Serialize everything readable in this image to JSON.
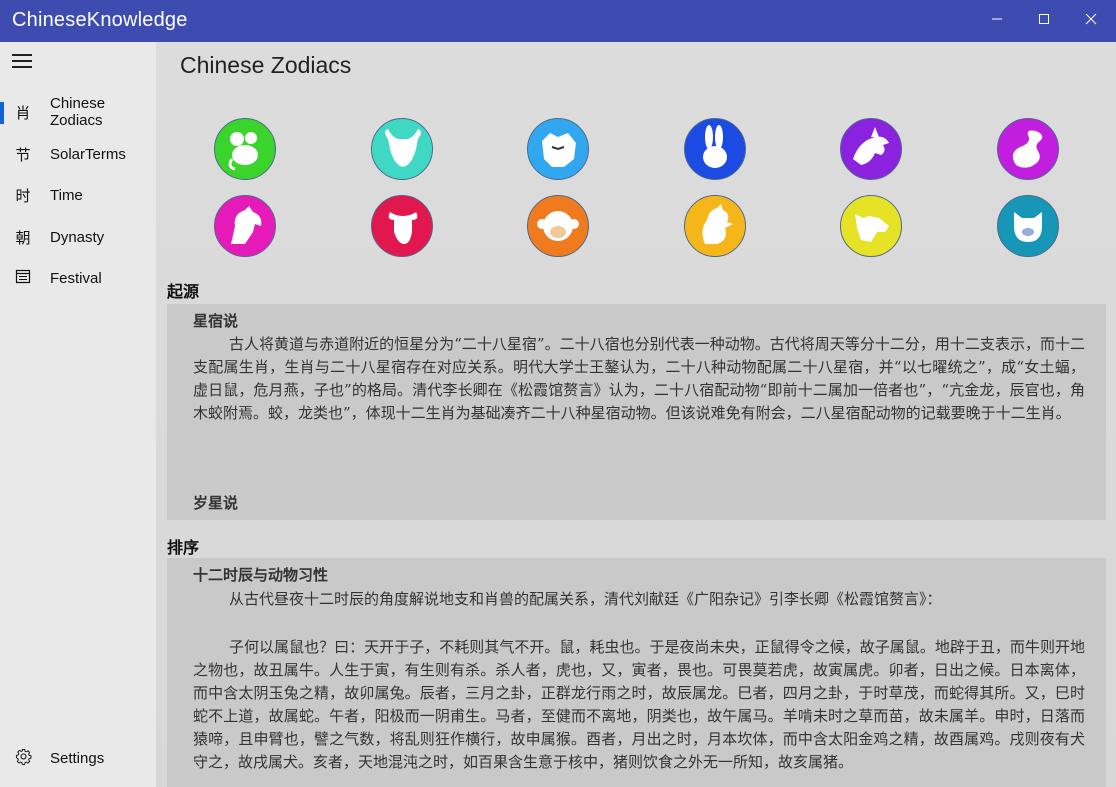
{
  "app": {
    "title": "ChineseKnowledge"
  },
  "window": {
    "minimize": "—",
    "maximize": "☐",
    "close": "✕"
  },
  "sidebar": {
    "items": [
      {
        "icon": "肖",
        "label": "Chinese Zodiacs"
      },
      {
        "icon": "节",
        "label": "SolarTerms"
      },
      {
        "icon": "时",
        "label": "Time"
      },
      {
        "icon": "朝",
        "label": "Dynasty"
      },
      {
        "icon": "festival-icon",
        "label": "Festival"
      }
    ],
    "settings": {
      "icon": "gear-icon",
      "label": "Settings"
    }
  },
  "page": {
    "title": "Chinese Zodiacs"
  },
  "zodiacs": [
    {
      "name": "rat",
      "color": "#3bd42c"
    },
    {
      "name": "ox",
      "color": "#3fd8c5"
    },
    {
      "name": "tiger",
      "color": "#31a7f0"
    },
    {
      "name": "rabbit",
      "color": "#1b4be3"
    },
    {
      "name": "dragon",
      "color": "#8b22e0"
    },
    {
      "name": "snake",
      "color": "#c21ee0"
    },
    {
      "name": "horse",
      "color": "#e61ab8"
    },
    {
      "name": "goat",
      "color": "#e31750"
    },
    {
      "name": "monkey",
      "color": "#f07a1e"
    },
    {
      "name": "rooster",
      "color": "#f5b61a"
    },
    {
      "name": "dog",
      "color": "#e6e226"
    },
    {
      "name": "pig",
      "color": "#1797b8"
    }
  ],
  "sections": {
    "origin": {
      "heading": "起源",
      "sub1": "星宿说",
      "para1": "古人将黄道与赤道附近的恒星分为“二十八星宿”。二十八宿也分别代表一种动物。古代将周天等分十二分，用十二支表示，而十二支配属生肖，生肖与二十八星宿存在对应关系。明代大学士王鏊认为，二十八种动物配属二十八星宿，并“以七曜统之”，成“女土蝠，虚日鼠，危月燕，子也”的格局。清代李长卿在《松霞馆赘言》认为，二十八宿配动物“即前十二属加一倍者也”，“亢金龙，辰官也，角木蛟附焉。蛟，龙类也”，体现十二生肖为基础凑齐二十八种星宿动物。但该说难免有附会，二八星宿配动物的记载要晚于十二生肖。",
      "sub2": "岁星说"
    },
    "order": {
      "heading": "排序",
      "sub1": "十二时辰与动物习性",
      "para1": "从古代昼夜十二时辰的角度解说地支和肖兽的配属关系，清代刘献廷《广阳杂记》引李长卿《松霞馆赘言》：",
      "para2": "子何以属鼠也？曰：天开于子，不耗则其气不开。鼠，耗虫也。于是夜尚未央，正鼠得令之候，故子属鼠。地辟于丑，而牛则开地之物也，故丑属牛。人生于寅，有生则有杀。杀人者，虎也，又，寅者，畏也。可畏莫若虎，故寅属虎。卯者，日出之候。日本离体，而中含太阴玉兔之精，故卯属兔。辰者，三月之卦，正群龙行雨之时，故辰属龙。巳者，四月之卦，于时草茂，而蛇得其所。又，巳时蛇不上道，故属蛇。午者，阳极而一阴甫生。马者，至健而不离地，阴类也，故午属马。羊啃未时之草而苗，故未属羊。申时，日落而猿啼，且申臂也，譬之气数，将乱则狂作横行，故申属猴。酉者，月出之时，月本坎体，而中含太阳金鸡之精，故酉属鸡。戌则夜有犬守之，故戌属犬。亥者，天地混沌之时，如百果含生意于核中，猪则饮食之外无一所知，故亥属猪。"
    }
  }
}
